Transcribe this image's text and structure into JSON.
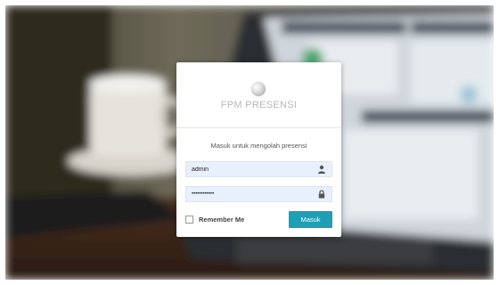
{
  "app": {
    "name": "FPM PRESENSI"
  },
  "login": {
    "subtitle": "Masuk untuk mengolah presensi",
    "username_value": "admin",
    "password_value": "••••••••••••",
    "remember_label": "Remember Me",
    "submit_label": "Masuk"
  },
  "icons": {
    "username": "user-icon",
    "password": "lock-icon",
    "logo": "logo-circle"
  },
  "colors": {
    "accent": "#1f9fb5",
    "input_bg": "#e8f0fe"
  }
}
